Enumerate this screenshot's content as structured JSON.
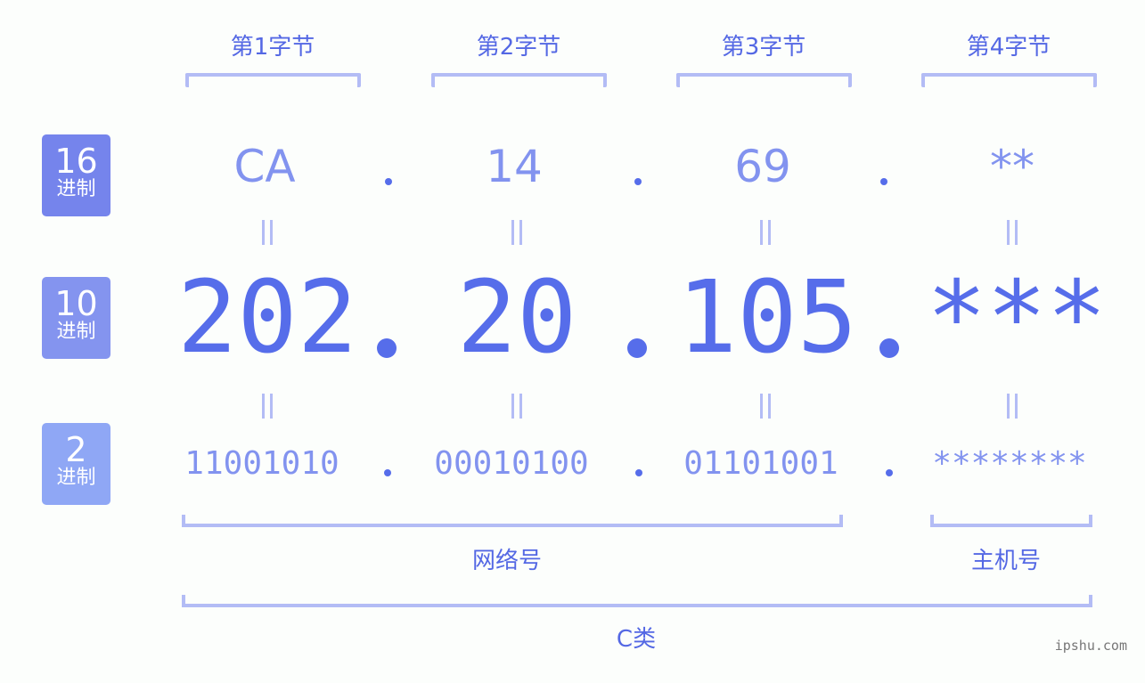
{
  "bytes": [
    {
      "title": "第1字节",
      "hex": "CA",
      "dec": "202",
      "bin": "11001010"
    },
    {
      "title": "第2字节",
      "hex": "14",
      "dec": "20",
      "bin": "00010100"
    },
    {
      "title": "第3字节",
      "hex": "69",
      "dec": "105",
      "bin": "01101001"
    },
    {
      "title": "第4字节",
      "hex": "**",
      "dec": "***",
      "bin": "********"
    }
  ],
  "badges": {
    "hex": {
      "num": "16",
      "sub": "进制",
      "color": "#7584ec"
    },
    "dec": {
      "num": "10",
      "sub": "进制",
      "color": "#8494ef"
    },
    "bin": {
      "num": "2",
      "sub": "进制",
      "color": "#8fa7f5"
    }
  },
  "groups": {
    "network": "网络号",
    "host": "主机号",
    "class": "C类"
  },
  "watermark": "ipshu.com"
}
